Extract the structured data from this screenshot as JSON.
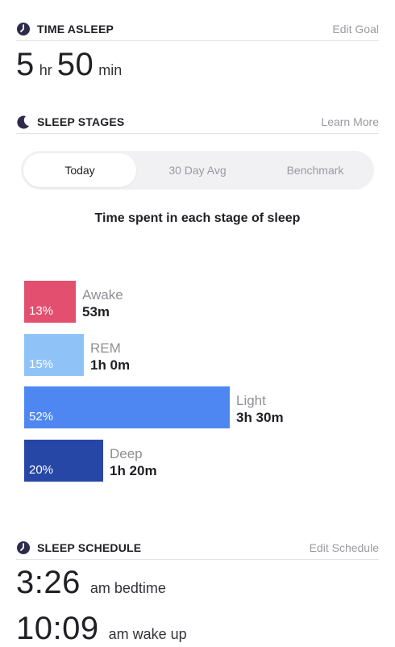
{
  "time_asleep": {
    "title": "TIME ASLEEP",
    "action": "Edit Goal",
    "hours": "5",
    "hours_unit": "hr",
    "minutes": "50",
    "minutes_unit": "min",
    "icon": "clock-icon"
  },
  "sleep_stages": {
    "title": "SLEEP STAGES",
    "action": "Learn More",
    "icon": "moon-icon",
    "tabs": [
      {
        "label": "Today",
        "active": true
      },
      {
        "label": "30 Day Avg",
        "active": false
      },
      {
        "label": "Benchmark",
        "active": false
      }
    ],
    "chart_title": "Time spent in each stage of sleep",
    "stages": [
      {
        "name": "Awake",
        "percent_label": "13%",
        "percent": 13,
        "duration": "53m",
        "color": "#e3506f"
      },
      {
        "name": "REM",
        "percent_label": "15%",
        "percent": 15,
        "duration": "1h 0m",
        "color": "#8fc3f8"
      },
      {
        "name": "Light",
        "percent_label": "52%",
        "percent": 52,
        "duration": "3h 30m",
        "color": "#4f87f2"
      },
      {
        "name": "Deep",
        "percent_label": "20%",
        "percent": 20,
        "duration": "1h 20m",
        "color": "#2747a7"
      }
    ]
  },
  "sleep_schedule": {
    "title": "SLEEP SCHEDULE",
    "action": "Edit Schedule",
    "icon": "clock-icon",
    "bedtime": "3:26",
    "bedtime_label": "am bedtime",
    "wakeup": "10:09",
    "wakeup_label": "am wake up"
  },
  "colors": {
    "icon_accent": "#2d2a4a",
    "muted_text": "#9a9aa2"
  }
}
